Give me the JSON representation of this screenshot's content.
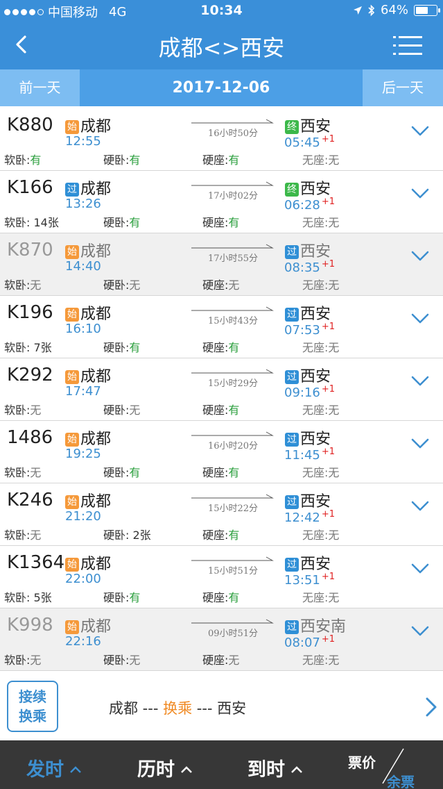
{
  "status_bar": {
    "carrier": "中国移动",
    "network": "4G",
    "time": "10:34",
    "battery": "64%",
    "battery_level": 0.64
  },
  "nav": {
    "title": "成都<>西安",
    "back_icon": "chevron-left-icon",
    "menu_icon": "list-menu-icon"
  },
  "date_bar": {
    "prev_label": "前一天",
    "date": "2017-12-06",
    "next_label": "后一天"
  },
  "colors": {
    "primary": "#3a8fd9",
    "accent_orange": "#f5993a",
    "badge_blue": "#2f8fd6",
    "badge_green": "#3cb84a",
    "yes_green": "#2a9e3c",
    "plus_red": "#e02020"
  },
  "seat_labels": {
    "soft_sleeper": "软卧:",
    "hard_sleeper": "硬卧:",
    "hard_seat": "硬座:",
    "no_seat": "无座:"
  },
  "trains": [
    {
      "number": "K880",
      "dep_badge": "始",
      "dep_station": "成都",
      "dep_time": "12:55",
      "duration": "16小时50分",
      "arr_badge": "终",
      "arr_station": "西安",
      "arr_time": "05:45",
      "plus": "+1",
      "soft": "有",
      "hard": "有",
      "seat": "有",
      "noseat": "无",
      "gray": false
    },
    {
      "number": "K166",
      "dep_badge": "过",
      "dep_station": "成都",
      "dep_time": "13:26",
      "duration": "17小时02分",
      "arr_badge": "终",
      "arr_station": "西安",
      "arr_time": "06:28",
      "plus": "+1",
      "soft": " 14张",
      "hard": "有",
      "seat": "有",
      "noseat": "无",
      "gray": false
    },
    {
      "number": "K870",
      "dep_badge": "始",
      "dep_station": "成都",
      "dep_time": "14:40",
      "duration": "17小时55分",
      "arr_badge": "过",
      "arr_station": "西安",
      "arr_time": "08:35",
      "plus": "+1",
      "soft": "无",
      "hard": "无",
      "seat": "无",
      "noseat": "无",
      "gray": true
    },
    {
      "number": "K196",
      "dep_badge": "始",
      "dep_station": "成都",
      "dep_time": "16:10",
      "duration": "15小时43分",
      "arr_badge": "过",
      "arr_station": "西安",
      "arr_time": "07:53",
      "plus": "+1",
      "soft": " 7张",
      "hard": "有",
      "seat": "有",
      "noseat": "无",
      "gray": false
    },
    {
      "number": "K292",
      "dep_badge": "始",
      "dep_station": "成都",
      "dep_time": "17:47",
      "duration": "15小时29分",
      "arr_badge": "过",
      "arr_station": "西安",
      "arr_time": "09:16",
      "plus": "+1",
      "soft": "无",
      "hard": "无",
      "seat": "有",
      "noseat": "无",
      "gray": false
    },
    {
      "number": "1486",
      "dep_badge": "始",
      "dep_station": "成都",
      "dep_time": "19:25",
      "duration": "16小时20分",
      "arr_badge": "过",
      "arr_station": "西安",
      "arr_time": "11:45",
      "plus": "+1",
      "soft": "无",
      "hard": "有",
      "seat": "有",
      "noseat": "无",
      "gray": false
    },
    {
      "number": "K246",
      "dep_badge": "始",
      "dep_station": "成都",
      "dep_time": "21:20",
      "duration": "15小时22分",
      "arr_badge": "过",
      "arr_station": "西安",
      "arr_time": "12:42",
      "plus": "+1",
      "soft": "无",
      "hard": " 2张",
      "seat": "有",
      "noseat": "无",
      "gray": false
    },
    {
      "number": "K1364",
      "dep_badge": "始",
      "dep_station": "成都",
      "dep_time": "22:00",
      "duration": "15小时51分",
      "arr_badge": "过",
      "arr_station": "西安",
      "arr_time": "13:51",
      "plus": "+1",
      "soft": " 5张",
      "hard": "有",
      "seat": "有",
      "noseat": "无",
      "gray": false
    },
    {
      "number": "K998",
      "dep_badge": "始",
      "dep_station": "成都",
      "dep_time": "22:16",
      "duration": "09小时51分",
      "arr_badge": "过",
      "arr_station": "西安南",
      "arr_time": "08:07",
      "plus": "+1",
      "soft": "无",
      "hard": "无",
      "seat": "无",
      "noseat": "无",
      "gray": true
    }
  ],
  "transfer": {
    "button_line1": "接续",
    "button_line2": "换乘",
    "from": "成都 --- ",
    "middle": "换乘",
    "to": " --- 西安"
  },
  "tabbar": {
    "depart": "发时",
    "duration": "历时",
    "arrive": "到时",
    "price": "票价",
    "remaining": "余票"
  }
}
